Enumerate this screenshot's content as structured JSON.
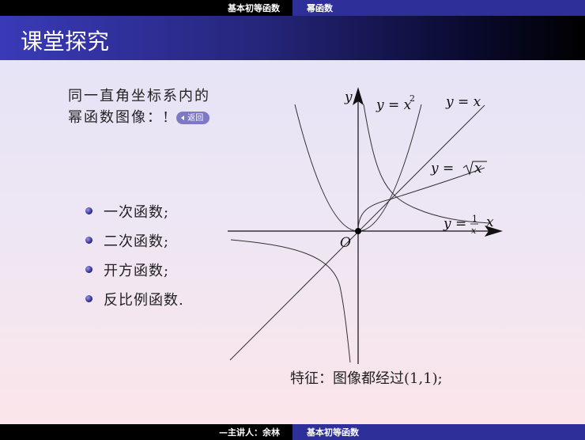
{
  "header": {
    "section": "基本初等函数",
    "subsection": "幂函数"
  },
  "slide": {
    "title": "课堂探究",
    "intro_line1": "同一直角坐标系内的",
    "intro_line2": "幂函数图像：!",
    "back_button": "返回",
    "bullets": [
      "一次函数;",
      "二次函数;",
      "开方函数;",
      "反比例函数."
    ],
    "feature": "特征：图像都经过(1,1);"
  },
  "graph": {
    "y_axis": "y",
    "x_axis": "x",
    "origin": "O",
    "curve_labels": {
      "square": "y = x",
      "square_exp": "2",
      "identity": "y = x",
      "sqrt_prefix": "y =",
      "sqrt_arg": "x",
      "recip_prefix": "y =",
      "recip_num": "1",
      "recip_den": "x"
    }
  },
  "footer": {
    "presenter": "—主讲人：余林",
    "course": "基本初等函数"
  },
  "colors": {
    "top_bar_left": "#000000",
    "top_bar_right": "#2f2f9a",
    "title_gradient_start": "#3a3ab8",
    "bullet": "#24208a",
    "back_button": "#7d79c4"
  }
}
